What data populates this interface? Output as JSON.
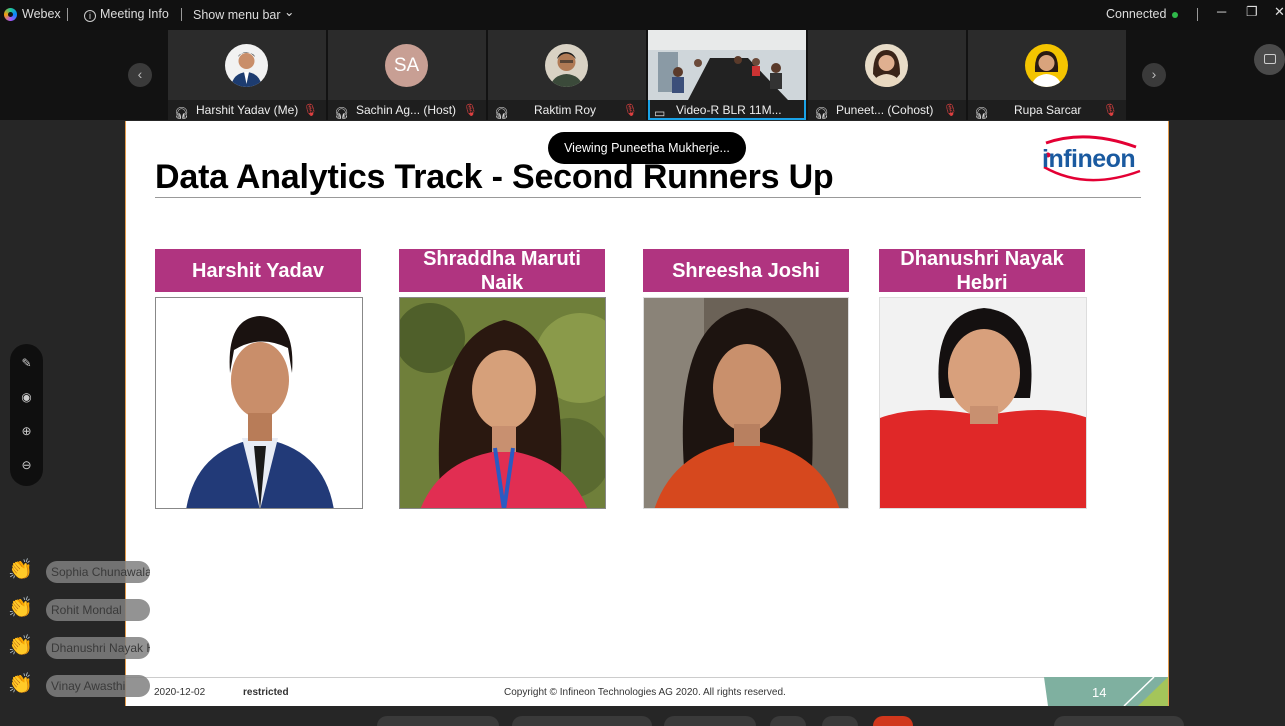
{
  "topbar": {
    "app_name": "Webex",
    "meeting_info": "Meeting Info",
    "show_menu_bar": "Show menu bar",
    "chevron": "⌄",
    "status": "Connected",
    "minimize": "─",
    "restore": "❐",
    "close": "✕"
  },
  "participants": [
    {
      "label": "Harshit Yadav  (Me)",
      "icon": "headset-icon",
      "muted": true
    },
    {
      "label": "Sachin Ag...  (Host)",
      "initials": "SA",
      "icon": "headset-icon",
      "muted": true
    },
    {
      "label": "Raktim Roy",
      "icon": "headset-icon",
      "muted": true
    },
    {
      "label": "Video-R BLR 11M...",
      "icon": "room-device-icon",
      "muted": false
    },
    {
      "label": "Puneet...  (Cohost)",
      "icon": "sharing-headset-icon",
      "muted": true
    },
    {
      "label": "Rupa Sarcar",
      "icon": "headset-icon",
      "muted": true
    }
  ],
  "strip_nav": {
    "prev": "‹",
    "next": "›"
  },
  "viewing_banner": "Viewing Puneetha Mukherje...",
  "slide": {
    "title": "Data Analytics Track - Second Runners Up",
    "logo_text": "infineon",
    "cards": [
      {
        "name": "Harshit Yadav"
      },
      {
        "name": "Shraddha Maruti Naik"
      },
      {
        "name": "Shreesha Joshi"
      },
      {
        "name": "Dhanushri Nayak Hebri"
      }
    ],
    "footer_date": "2020-12-02",
    "footer_class": "restricted",
    "footer_copyright": "Copyright © Infineon Technologies AG 2020. All rights reserved.",
    "page_number": "14",
    "colors": {
      "banner": "#b03480",
      "accent_teal": "#7fb0a0",
      "accent_green": "#a4c55a"
    }
  },
  "annotation_tools": [
    "pen-icon",
    "pointer-icon",
    "zoom-in-icon",
    "zoom-out-icon"
  ],
  "reactions": [
    {
      "name": "Sophia Chunawala"
    },
    {
      "name": "Rohit Mondal"
    },
    {
      "name": "Dhanushri Nayak H"
    },
    {
      "name": "Vinay Awasthi"
    }
  ]
}
